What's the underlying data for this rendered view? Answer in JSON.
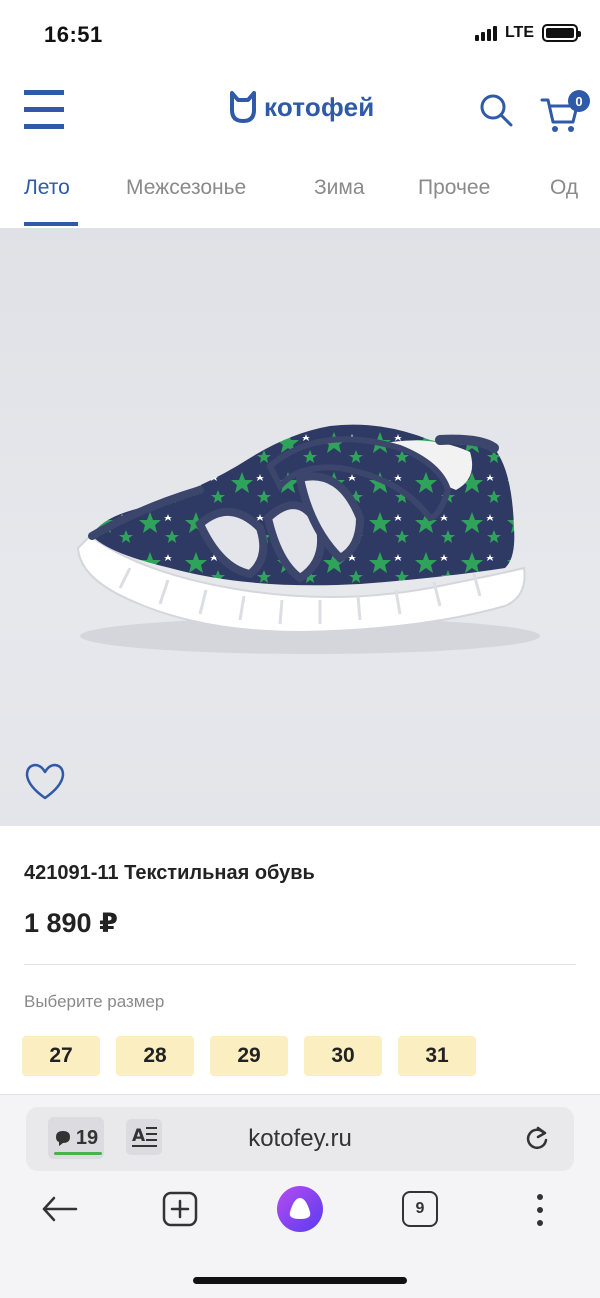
{
  "status_bar": {
    "time": "16:51",
    "network": "LTE"
  },
  "header": {
    "logo_text": "котофей",
    "cart_count": "0"
  },
  "tabs": [
    {
      "label": "Лето",
      "active": true
    },
    {
      "label": "Межсезонье",
      "active": false
    },
    {
      "label": "Зима",
      "active": false
    },
    {
      "label": "Прочее",
      "active": false
    },
    {
      "label": "Од",
      "active": false
    }
  ],
  "product": {
    "title": "421091-11 Текстильная обувь",
    "price": "1 890 ₽",
    "size_prompt": "Выберите размер",
    "sizes": [
      "27",
      "28",
      "29",
      "30",
      "31"
    ],
    "image_subject": "Children's navy textile sandal with green star print and white sole"
  },
  "browser": {
    "comments_count": "19",
    "url": "kotofey.ru",
    "tabs_count": "9"
  },
  "colors": {
    "brand_blue": "#2f5aa8",
    "size_chip": "#fbeec1",
    "tab_inactive": "#8a8a8a",
    "alice_purple": "#7a3cf0"
  }
}
